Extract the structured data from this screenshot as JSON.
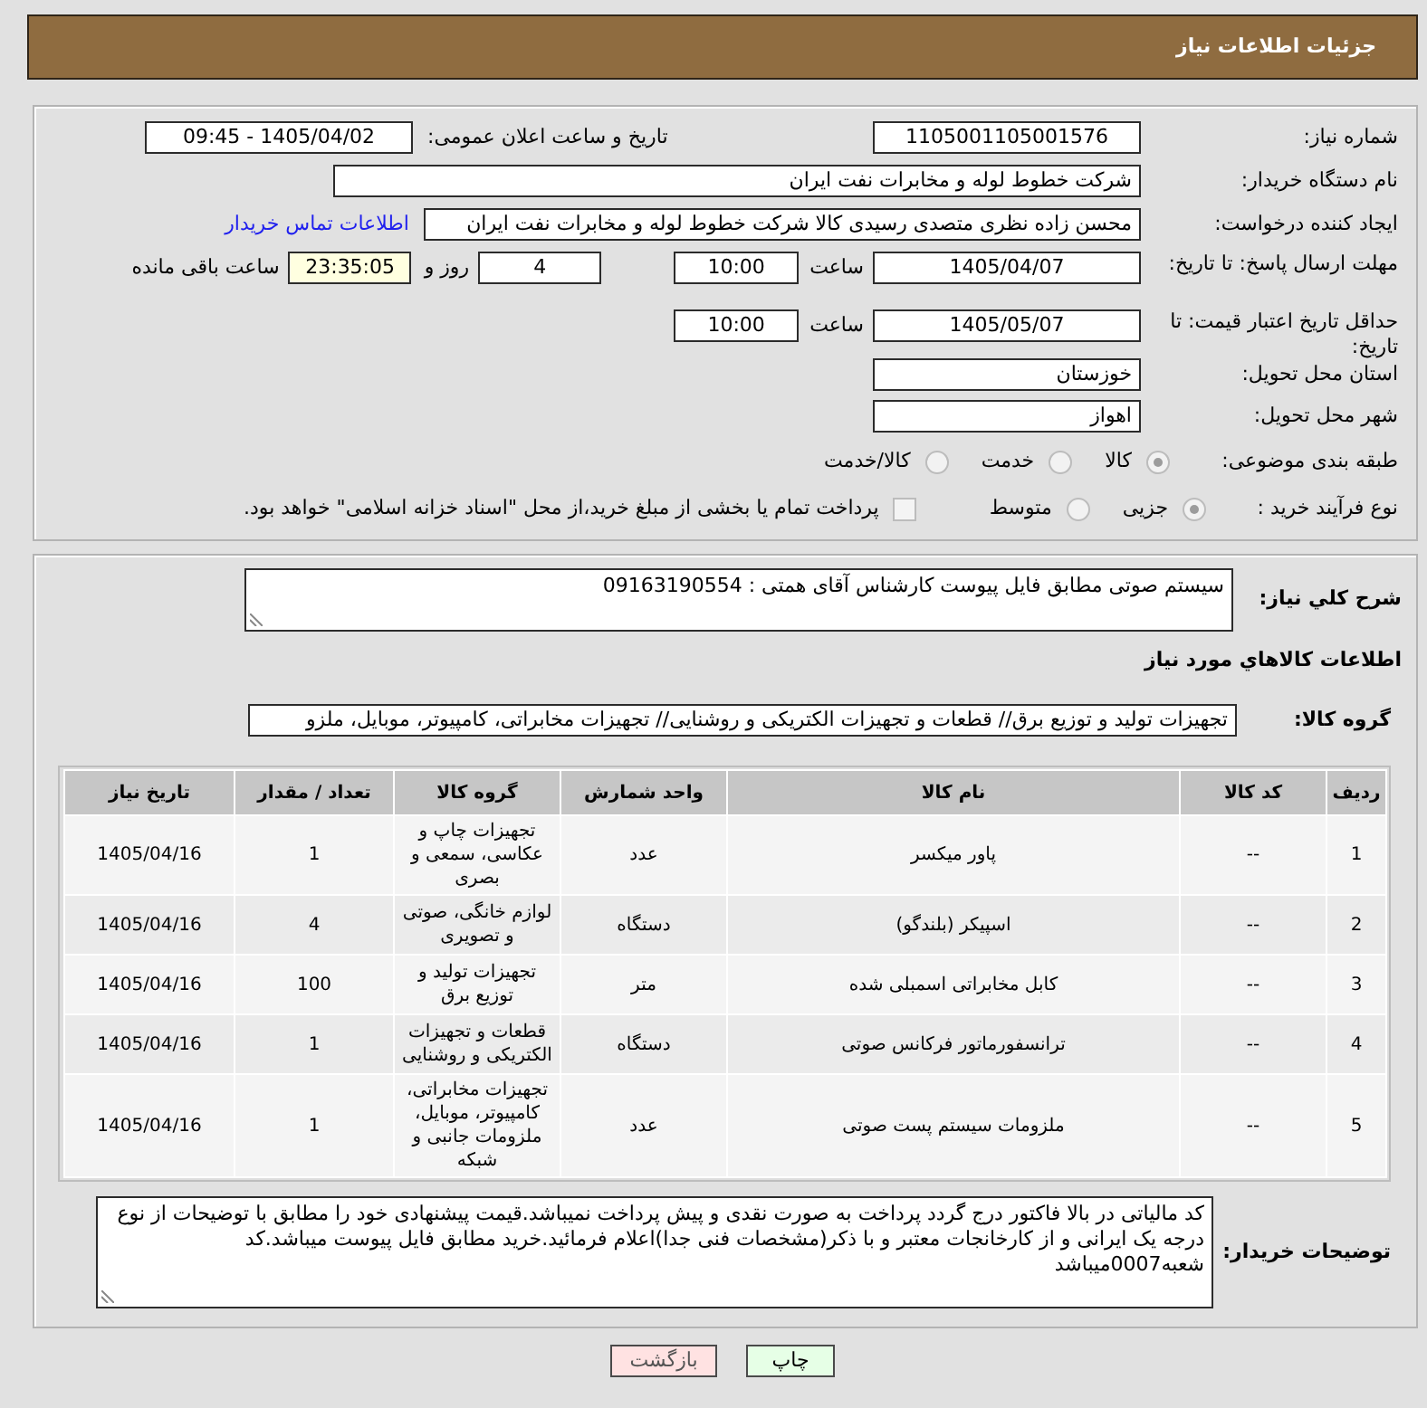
{
  "header": {
    "title": "جزئیات اطلاعات نیاز"
  },
  "details": {
    "need_number": {
      "label": "شماره نیاز:",
      "value": "1105001105001576"
    },
    "announcement": {
      "label": "تاریخ و ساعت اعلان عمومی:",
      "value": "1405/04/02 - 09:45"
    },
    "buyer_org": {
      "label": "نام دستگاه خریدار:",
      "value": "شرکت خطوط لوله و مخابرات نفت ایران"
    },
    "requester": {
      "label": "ایجاد کننده درخواست:",
      "value": "محسن زاده نظری متصدی رسیدی کالا شرکت خطوط لوله و مخابرات نفت ایران",
      "contact_link": "اطلاعات تماس خریدار"
    },
    "reply_deadline": {
      "label": "مهلت ارسال پاسخ: تا تاریخ:",
      "date": "1405/04/07",
      "time_label": "ساعت",
      "time": "10:00",
      "days": "4",
      "days_label": "روز و",
      "remaining": "23:35:05",
      "remaining_label": "ساعت باقی مانده"
    },
    "price_validity": {
      "label": "حداقل تاریخ اعتبار قیمت: تا تاریخ:",
      "date": "1405/05/07",
      "time_label": "ساعت",
      "time": "10:00"
    },
    "province": {
      "label": "استان محل تحویل:",
      "value": "خوزستان"
    },
    "city": {
      "label": "شهر محل تحویل:",
      "value": "اهواز"
    },
    "category": {
      "label": "طبقه بندی موضوعی:",
      "options": [
        {
          "label": "کالا",
          "selected": true
        },
        {
          "label": "خدمت",
          "selected": false
        },
        {
          "label": "کالا/خدمت",
          "selected": false
        }
      ]
    },
    "purchase_type": {
      "label": "نوع فرآیند خرید :",
      "options": [
        {
          "label": "جزیی",
          "selected": true
        },
        {
          "label": "متوسط",
          "selected": false
        }
      ],
      "treasury_payment": {
        "label": "پرداخت تمام یا بخشی از مبلغ خرید،از محل \"اسناد خزانه اسلامی\" خواهد بود.",
        "checked": false
      }
    }
  },
  "description": {
    "label": "شرح کلي نیاز:",
    "value": "سیستم صوتی مطابق فایل پیوست کارشناس آقای همتی : 09163190554"
  },
  "goods": {
    "title": "اطلاعات کالاهاي مورد نیاز",
    "group_label": "گروه کالا:",
    "group_value": "تجهیزات تولید و توزیع برق// قطعات و تجهیزات الکتریکی و روشنایی// تجهیزات مخابراتی، کامپیوتر، موبایل، ملزو",
    "table": {
      "columns": [
        "ردیف",
        "کد کالا",
        "نام کالا",
        "واحد شمارش",
        "گروه کالا",
        "تعداد / مقدار",
        "تاریخ نیاز"
      ],
      "rows": [
        [
          "1",
          "--",
          "پاور میکسر",
          "عدد",
          "تجهیزات چاپ و عکاسی، سمعی و بصری",
          "1",
          "1405/04/16"
        ],
        [
          "2",
          "--",
          "اسپیکر (بلندگو)",
          "دستگاه",
          "لوازم خانگی، صوتی و تصویری",
          "4",
          "1405/04/16"
        ],
        [
          "3",
          "--",
          "کابل مخابراتی اسمبلی شده",
          "متر",
          "تجهیزات تولید و توزیع برق",
          "100",
          "1405/04/16"
        ],
        [
          "4",
          "--",
          "ترانسفورماتور فرکانس صوتی",
          "دستگاه",
          "قطعات و تجهیزات الکتریکی و روشنایی",
          "1",
          "1405/04/16"
        ],
        [
          "5",
          "--",
          "ملزومات سیستم پست صوتی",
          "عدد",
          "تجهیزات مخابراتی، کامپیوتر، موبایل، ملزومات جانبی و شبکه",
          "1",
          "1405/04/16"
        ]
      ]
    }
  },
  "buyer_notes": {
    "label": "توضیحات خریدار:",
    "value": "کد مالیاتی در بالا فاکتور درج گردد پرداخت به صورت نقدی و پیش پرداخت نمیباشد.قیمت پیشنهادی خود را مطابق با توضیحات از نوع درجه یک ایرانی و از کارخانجات معتبر و با ذکر(مشخصات فنی جدا)اعلام فرمائید.خرید مطابق فایل پیوست میباشد.کد شعبه0007میباشد"
  },
  "buttons": [
    {
      "kind": "print",
      "label": "چاپ"
    },
    {
      "kind": "back",
      "label": "بازگشت"
    }
  ]
}
